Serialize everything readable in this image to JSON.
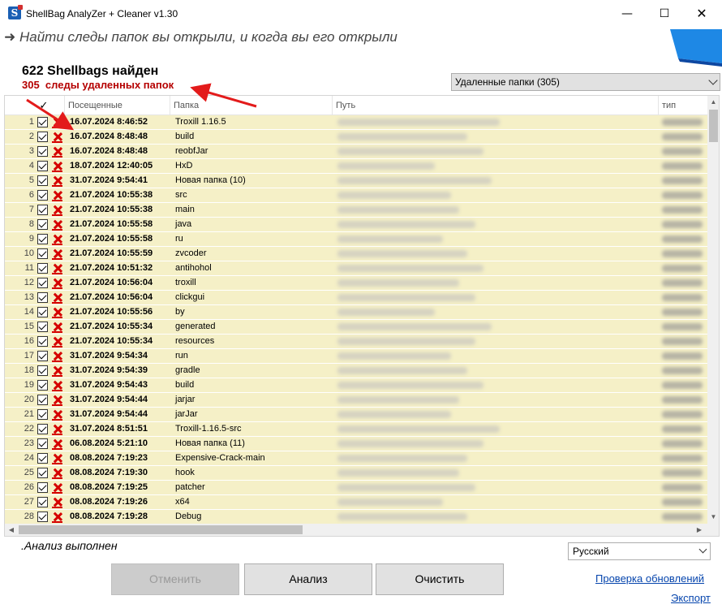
{
  "window": {
    "title": "ShellBag  AnalyZer + Cleaner v1.30",
    "minimize": "—",
    "maximize": "☐",
    "close": "✕"
  },
  "subtitle": {
    "arrow": "➜",
    "text": "Найти следы папок вы открыли, и когда вы его открыли"
  },
  "summary": {
    "count_title": "622 Shellbags найден",
    "deleted_info": "305  следы удаленных папок"
  },
  "filter": {
    "selected": "Удаленные папки   (305)"
  },
  "table": {
    "columns": {
      "check": "✓",
      "visited": "Посещенные",
      "folder": "Папка",
      "path": "Путь",
      "type": "тип"
    },
    "rows": [
      {
        "n": "1",
        "date": "16.07.2024 8:46:52",
        "folder": "Troxill 1.16.5"
      },
      {
        "n": "2",
        "date": "16.07.2024 8:48:48",
        "folder": "build"
      },
      {
        "n": "3",
        "date": "16.07.2024 8:48:48",
        "folder": "reobfJar"
      },
      {
        "n": "4",
        "date": "18.07.2024 12:40:05",
        "folder": "HxD"
      },
      {
        "n": "5",
        "date": "31.07.2024 9:54:41",
        "folder": "Новая папка (10)"
      },
      {
        "n": "6",
        "date": "21.07.2024 10:55:38",
        "folder": "src"
      },
      {
        "n": "7",
        "date": "21.07.2024 10:55:38",
        "folder": "main"
      },
      {
        "n": "8",
        "date": "21.07.2024 10:55:58",
        "folder": "java"
      },
      {
        "n": "9",
        "date": "21.07.2024 10:55:58",
        "folder": "ru"
      },
      {
        "n": "10",
        "date": "21.07.2024 10:55:59",
        "folder": "zvcoder"
      },
      {
        "n": "11",
        "date": "21.07.2024 10:51:32",
        "folder": "antihohol"
      },
      {
        "n": "12",
        "date": "21.07.2024 10:56:04",
        "folder": "troxill"
      },
      {
        "n": "13",
        "date": "21.07.2024 10:56:04",
        "folder": "clickgui"
      },
      {
        "n": "14",
        "date": "21.07.2024 10:55:56",
        "folder": "by"
      },
      {
        "n": "15",
        "date": "21.07.2024 10:55:34",
        "folder": "generated"
      },
      {
        "n": "16",
        "date": "21.07.2024 10:55:34",
        "folder": "resources"
      },
      {
        "n": "17",
        "date": "31.07.2024 9:54:34",
        "folder": "run"
      },
      {
        "n": "18",
        "date": "31.07.2024 9:54:39",
        "folder": "gradle"
      },
      {
        "n": "19",
        "date": "31.07.2024 9:54:43",
        "folder": "build"
      },
      {
        "n": "20",
        "date": "31.07.2024 9:54:44",
        "folder": "jarjar"
      },
      {
        "n": "21",
        "date": "31.07.2024 9:54:44",
        "folder": "jarJar"
      },
      {
        "n": "22",
        "date": "31.07.2024 8:51:51",
        "folder": "Troxill-1.16.5-src"
      },
      {
        "n": "23",
        "date": "06.08.2024 5:21:10",
        "folder": "Новая папка (11)"
      },
      {
        "n": "24",
        "date": "08.08.2024 7:19:23",
        "folder": "Expensive-Crack-main"
      },
      {
        "n": "25",
        "date": "08.08.2024 7:19:30",
        "folder": "hook"
      },
      {
        "n": "26",
        "date": "08.08.2024 7:19:25",
        "folder": "patcher"
      },
      {
        "n": "27",
        "date": "08.08.2024 7:19:26",
        "folder": "x64"
      },
      {
        "n": "28",
        "date": "08.08.2024 7:19:28",
        "folder": "Debug"
      }
    ]
  },
  "status": {
    "text": ".Анализ выполнен"
  },
  "language": {
    "selected": "Русский"
  },
  "buttons": {
    "cancel": "Отменить",
    "analyze": "Анализ",
    "clean": "Очистить"
  },
  "links": {
    "check_updates": "Проверка обновлений",
    "export": "Экспорт"
  },
  "colors": {
    "row_background": "#f5f0c7",
    "deleted_mark": "#d50000",
    "annotation_red": "#e31b1b",
    "link": "#0645ad",
    "accent_blue": "#1e88e5"
  },
  "icons": {
    "app": "shellbag-app-icon",
    "deleted_row": "red-cross-icon",
    "checkbox": "checked-checkbox-icon"
  }
}
